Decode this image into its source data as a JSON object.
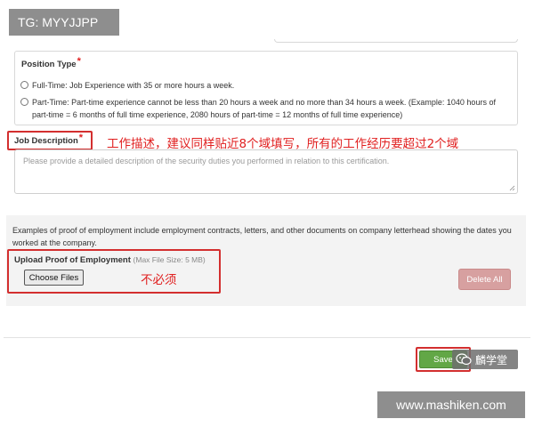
{
  "overlay": {
    "tg_label": "TG: MYYJJPP",
    "site_label": "www.mashiken.com",
    "wechat_badge_text": "麟学堂"
  },
  "position_type": {
    "label": "Position Type",
    "required_mark": "*",
    "options": [
      {
        "label": "Full-Time: Job Experience with 35 or more hours a week.",
        "selected": false
      },
      {
        "label": "Part-Time: Part-time experience cannot be less than 20 hours a week and no more than 34 hours a week. (Example: 1040 hours of part-time = 6 months of full time experience, 2080 hours of part-time = 12 months of full time experience)",
        "selected": false
      }
    ]
  },
  "job_description": {
    "label": "Job Description",
    "required_mark": "*",
    "placeholder": "Please provide a detailed description of the security duties you performed in relation to this certification.",
    "value": ""
  },
  "annotations": {
    "job_description_note": "工作描述，建议同样贴近8个域填写，所有的工作经历要超过2个域",
    "upload_note": "不必须"
  },
  "proof": {
    "description": "Examples of proof of employment include employment contracts, letters, and other documents on company letterhead showing the dates you worked at the company.",
    "upload_label": "Upload Proof of Employment",
    "max_size": "(Max File Size: 5 MB)",
    "choose_files_label": "Choose Files",
    "delete_all_label": "Delete All"
  },
  "actions": {
    "save_label": "Save"
  },
  "colors": {
    "required": "#e02020",
    "annotation_red": "#d32f2f",
    "save_green": "#62a746",
    "delete_disabled": "#d7a0a0"
  },
  "icons": {
    "wechat": "wechat-icon",
    "resize": "resize-handle-icon",
    "radio": "radio-icon"
  }
}
